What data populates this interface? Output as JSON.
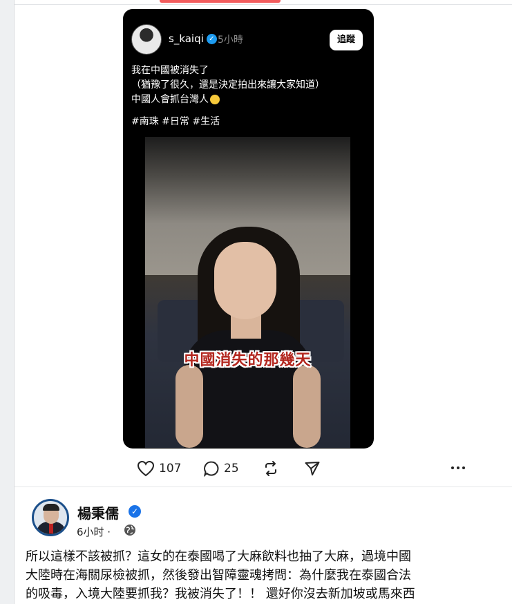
{
  "threads_post": {
    "username": "s_kaiqi",
    "time": "5小時",
    "follow_label": "追蹤",
    "text_lines": [
      "我在中國被消失了",
      "（猶豫了很久，還是決定拍出來讓大家知道）",
      "中國人會抓台灣人"
    ],
    "tags": "#南珠 #日常 #生活",
    "video_caption": "中國消失的那幾天"
  },
  "actions": {
    "like_count": "107",
    "comment_count": "25",
    "icons": [
      "heart-icon",
      "comment-icon",
      "repost-icon",
      "share-icon",
      "more-icon"
    ]
  },
  "fb_post": {
    "author": "楊秉儒",
    "time": "6小时 ·",
    "body_lines": [
      "所以這樣不該被抓？這女的在泰國喝了大麻飲料也抽了大麻，過境中國",
      "大陸時在海關尿檢被抓，然後發出智障靈魂拷問：為什麼我在泰國合法",
      "的吸毒，入境大陸要抓我？我被消失了！！ 還好你沒去新加坡或馬來西"
    ]
  },
  "colors": {
    "verified_blue": "#1d9bf0",
    "caption_red": "#b3261e",
    "card_bg": "#000000"
  }
}
